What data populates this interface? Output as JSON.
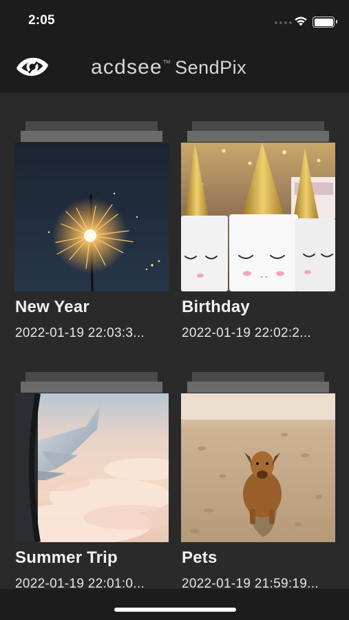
{
  "status_bar": {
    "time": "2:05"
  },
  "header": {
    "brand_prefix": "acdsee",
    "brand_tm": "TM",
    "brand_name": "SendPix"
  },
  "albums": [
    {
      "title": "New Year",
      "date": "2022-01-19 22:03:3..."
    },
    {
      "title": "Birthday",
      "date": "2022-01-19 22:02:2..."
    },
    {
      "title": "Summer Trip",
      "date": "2022-01-19 22:01:0..."
    },
    {
      "title": "Pets",
      "date": "2022-01-19 21:59:19..."
    }
  ],
  "icons": [
    "app-logo-icon",
    "wifi-icon",
    "battery-icon",
    "cellular-signal-icon"
  ],
  "colors": {
    "background": "#2a2a2a",
    "bar": "#1c1c1c",
    "text": "#ffffff",
    "stack": "#6b6b6b"
  }
}
